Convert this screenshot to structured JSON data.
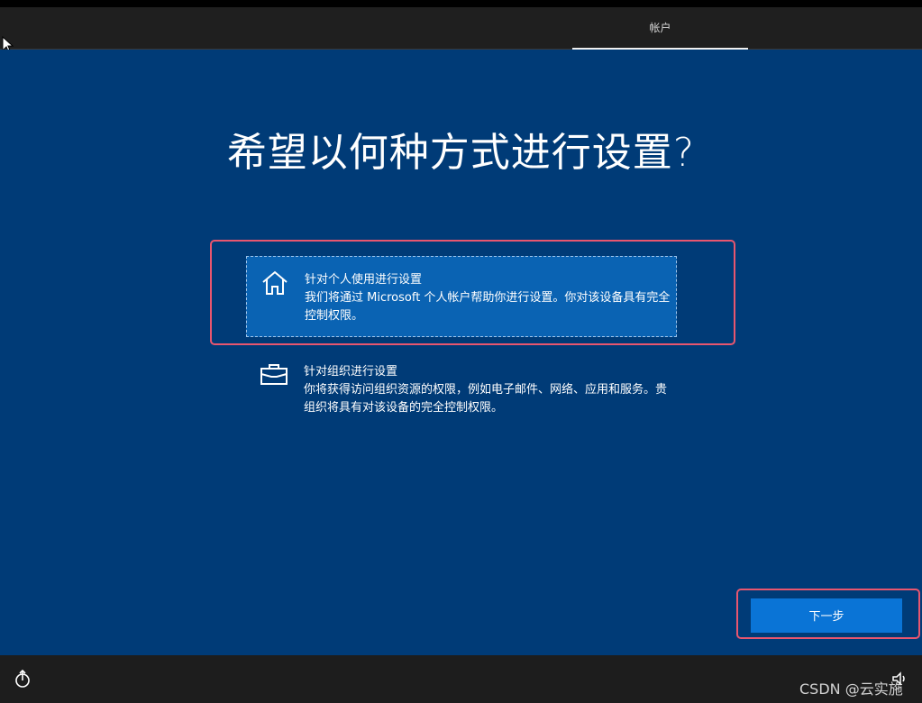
{
  "header": {
    "tab_label": "帐户"
  },
  "main": {
    "title": "希望以何种方式进行设置?",
    "options": [
      {
        "icon": "home-icon",
        "title": "针对个人使用进行设置",
        "description": "我们将通过 Microsoft 个人帐户帮助你进行设置。你对该设备具有完全控制权限。",
        "selected": true
      },
      {
        "icon": "briefcase-icon",
        "title": "针对组织进行设置",
        "description": "你将获得访问组织资源的权限，例如电子邮件、网络、应用和服务。贵组织将具有对该设备的完全控制权限。",
        "selected": false
      }
    ],
    "next_label": "下一步"
  },
  "footer": {
    "left_icon": "ease-of-access-icon",
    "right_icon": "volume-icon",
    "watermark": "CSDN @云实施"
  },
  "colors": {
    "background": "#003b77",
    "selected_option": "#0a63b3",
    "next_button": "#0a74d6",
    "highlight_border": "#e8566f"
  }
}
